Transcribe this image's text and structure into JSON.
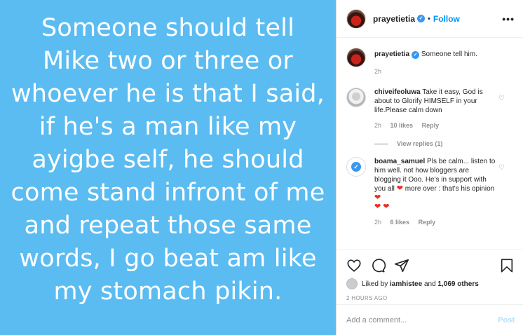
{
  "image": {
    "lines": [
      "Someone should tell",
      "Mike two or three or",
      "whoever he is that I said,",
      "if he's a man like my",
      "ayigbe self, he should",
      "come stand infront of me",
      "and repeat those same",
      "words, I go beat am like",
      "my stomach pikin."
    ],
    "background_color": "#5bbcf2"
  },
  "header": {
    "username": "prayetietia",
    "separator": "•",
    "follow_label": "Follow",
    "more_label": "•••"
  },
  "caption": {
    "username": "prayetietia",
    "text": "Someone tell him.",
    "time": "2h"
  },
  "comments": [
    {
      "username": "chiveifeoluwa",
      "text": "Take it easy, God is about to Glorify HIMSELF in your life.Please calm down",
      "time": "2h",
      "likes": "10 likes",
      "reply_label": "Reply",
      "view_replies": "View replies (1)"
    },
    {
      "username": "boama_samuel",
      "text": "Pls be calm... listen to him well. not how bloggers are blogging it Ooo. He's in support with you all",
      "text2": "more over : that's his opinion",
      "hearts": "❤ ❤",
      "heart_inline": "❤",
      "time": "2h",
      "likes": "6 likes",
      "reply_label": "Reply"
    }
  ],
  "likes": {
    "prefix": "Liked by",
    "user": "iamhistee",
    "middle": "and",
    "others": "1,069 others"
  },
  "timestamp": "2 HOURS AGO",
  "add_comment": {
    "placeholder": "Add a comment...",
    "post_label": "Post"
  },
  "colors": {
    "link_blue": "#0095f6",
    "post_disabled": "#b2dffc",
    "verified": "#3897f0",
    "heart_red": "#ed2a1f"
  },
  "icons": [
    "heart-icon",
    "comment-icon",
    "share-icon",
    "bookmark-icon",
    "verified-badge-icon",
    "more-icon"
  ]
}
